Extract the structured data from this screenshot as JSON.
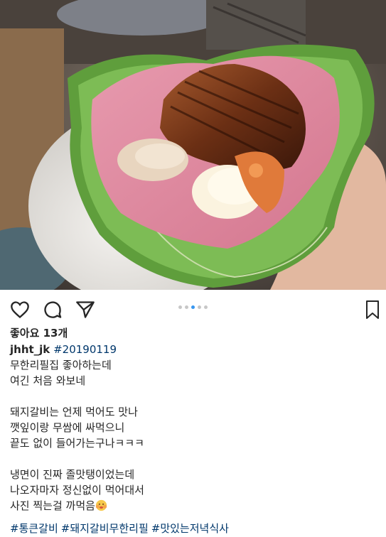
{
  "post": {
    "likes": "좋아요 13개",
    "username": "jhht_jk",
    "date_tag": "#20190119",
    "caption_lines": [
      "무한리필집 좋아하는데",
      "여긴 처음 와보네",
      "",
      "돼지갈비는 언제 먹어도 맛나",
      "깻잎이랑 무쌈에 싸먹으니",
      "끝도 없이 들어가는구나ㅋㅋㅋ",
      "",
      "냉면이 진짜 졸맛탱이었는데",
      "나오자마자 정신없이 먹어대서",
      "사진 찍는걸 까먹음"
    ],
    "hashtags": [
      "#통큰갈비",
      "#돼지갈비무한리필",
      "#맛있는저녁식사"
    ],
    "carousel": {
      "total": 5,
      "active": 3
    }
  },
  "icons": {
    "like": "heart-icon",
    "comment": "comment-icon",
    "share": "paper-plane-icon",
    "save": "bookmark-icon",
    "emoji": "face-emoji-icon"
  },
  "colors": {
    "text": "#262626",
    "link": "#00376b",
    "active_dot": "#3897f0",
    "inactive_dot": "#c7c7c7"
  }
}
